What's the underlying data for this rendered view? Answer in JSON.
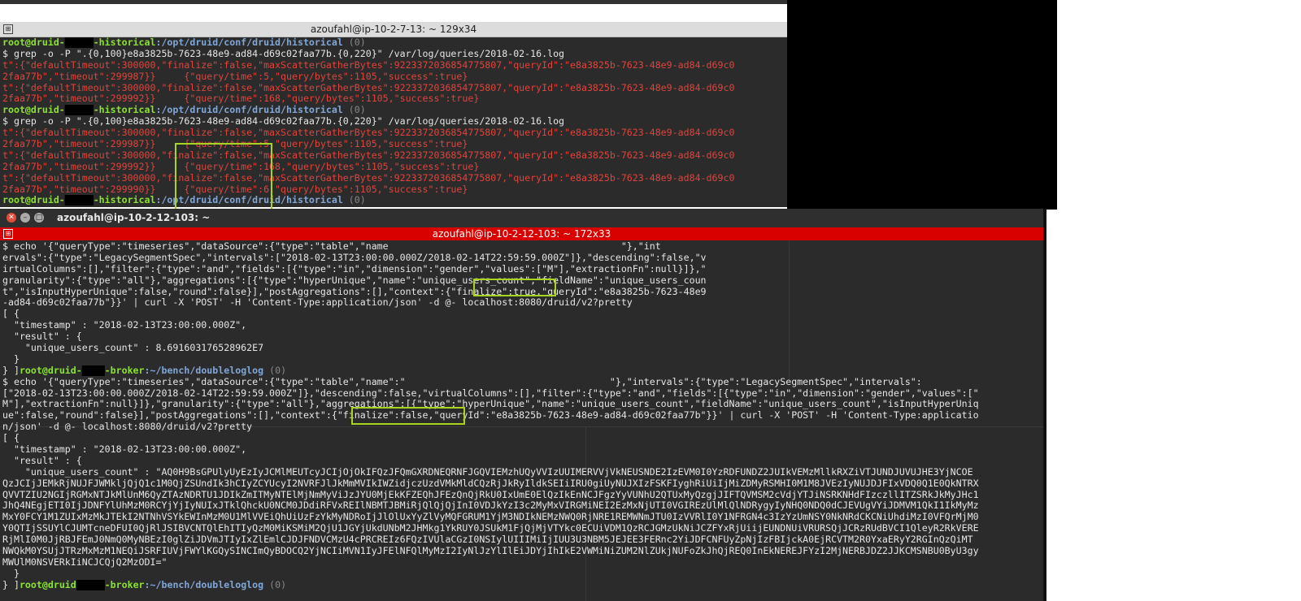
{
  "top_window": {
    "title": "azoufahl@ip-10-2-7-13: ~ 129x34",
    "lines": [
      [
        {
          "t": "root@druid-",
          "c": "green"
        },
        {
          "t": "█████",
          "c": "redact"
        },
        {
          "t": "-historical",
          "c": "green"
        },
        {
          "t": ":/opt/druid/conf/druid/historical",
          "c": "blue"
        },
        {
          "t": " (0)",
          "c": "gray"
        }
      ],
      [
        {
          "t": "$ grep -o -P \".{0,100}e8a3825b-7623-48e9-ad84-d69c02faa77b.{0,220}\" /var/log/queries/2018-02-16.log",
          "c": "white"
        }
      ],
      [
        {
          "t": "t\":{\"defaultTimeout\":300000,\"finalize\":false,\"maxScatterGatherBytes\":9223372036854775807,\"queryId\":\"e8a3825b-7623-48e9-ad84-d69c0",
          "c": "red"
        }
      ],
      [
        {
          "t": "2faa77b\",\"timeout\":299987}}     {\"query/time\":5,\"query/bytes\":1105,\"success\":true}",
          "c": "red"
        }
      ],
      [
        {
          "t": "t\":{\"defaultTimeout\":300000,\"finalize\":false,\"maxScatterGatherBytes\":9223372036854775807,\"queryId\":\"e8a3825b-7623-48e9-ad84-d69c0",
          "c": "red"
        }
      ],
      [
        {
          "t": "2faa77b\",\"timeout\":299992}}     {\"query/time\":168,\"query/bytes\":1105,\"success\":true}",
          "c": "red"
        }
      ],
      [
        {
          "t": "root@druid-",
          "c": "green"
        },
        {
          "t": "█████",
          "c": "redact"
        },
        {
          "t": "-historical",
          "c": "green"
        },
        {
          "t": ":/opt/druid/conf/druid/historical",
          "c": "blue"
        },
        {
          "t": " (0)",
          "c": "gray"
        }
      ],
      [
        {
          "t": "$ grep -o -P \".{0,100}e8a3825b-7623-48e9-ad84-d69c02faa77b.{0,220}\" /var/log/queries/2018-02-16.log",
          "c": "white"
        }
      ],
      [
        {
          "t": "t\":{\"defaultTimeout\":300000,\"finalize\":false,\"maxScatterGatherBytes\":9223372036854775807,\"queryId\":\"e8a3825b-7623-48e9-ad84-d69c0",
          "c": "red"
        }
      ],
      [
        {
          "t": "2faa77b\",\"timeout\":299987}}     {\"query/time\":5,\"query/bytes\":1105,\"success\":true}",
          "c": "red"
        }
      ],
      [
        {
          "t": "t\":{\"defaultTimeout\":300000,\"finalize\":false,\"maxScatterGatherBytes\":9223372036854775807,\"queryId\":\"e8a3825b-7623-48e9-ad84-d69c0",
          "c": "red"
        }
      ],
      [
        {
          "t": "2faa77b\",\"timeout\":299992}}     {\"query/time\":168,\"query/bytes\":1105,\"success\":true}",
          "c": "red"
        }
      ],
      [
        {
          "t": "t\":{\"defaultTimeout\":300000,\"finalize\":false,\"maxScatterGatherBytes\":9223372036854775807,\"queryId\":\"e8a3825b-7623-48e9-ad84-d69c0",
          "c": "red"
        }
      ],
      [
        {
          "t": "2faa77b\",\"timeout\":299990}}     {\"query/time\":6,\"query/bytes\":1105,\"success\":true}",
          "c": "red"
        }
      ],
      [
        {
          "t": "root@druid-",
          "c": "green"
        },
        {
          "t": "█████",
          "c": "redact"
        },
        {
          "t": "-historical",
          "c": "green"
        },
        {
          "t": ":/opt/druid/conf/druid/historical",
          "c": "blue"
        },
        {
          "t": " (0)",
          "c": "gray"
        }
      ]
    ]
  },
  "bottom_window": {
    "header_title": "azoufahl@ip-10-2-12-103: ~",
    "title": "azoufahl@ip-10-2-12-103: ~ 172x33",
    "lines": [
      [
        {
          "t": "$ echo '{\"queryType\":\"timeseries\",\"dataSource\":{\"type\":\"table\",\"name                                         \"},\"int",
          "c": "white"
        }
      ],
      [
        {
          "t": "ervals\":{\"type\":\"LegacySegmentSpec\",\"intervals\":[\"2018-02-13T23:00:00.000Z/2018-02-14T22:59:59.000Z\"]},\"descending\":false,\"v",
          "c": "white"
        }
      ],
      [
        {
          "t": "irtualColumns\":[],\"filter\":{\"type\":\"and\",\"fields\":[{\"type\":\"in\",\"dimension\":\"gender\",\"values\":[\"M\"],\"extractionFn\":null}]},\"",
          "c": "white"
        }
      ],
      [
        {
          "t": "granularity\":{\"type\":\"all\"},\"aggregations\":[{\"type\":\"hyperUnique\",\"name\":\"unique_users_count\",\"fieldName\":\"unique_users_coun",
          "c": "white"
        }
      ],
      [
        {
          "t": "t\",\"isInputHyperUnique\":false,\"round\":false}],\"postAggregations\":[],\"context\":{\"finalize\":true,\"queryId\":\"e8a3825b-7623-48e9",
          "c": "white"
        }
      ],
      [
        {
          "t": "-ad84-d69c02faa77b\"}}' | curl -X 'POST' -H 'Content-Type:application/json' -d @- localhost:8080/druid/v2?pretty",
          "c": "white"
        }
      ],
      [
        {
          "t": "[ {",
          "c": "white"
        }
      ],
      [
        {
          "t": "  \"timestamp\" : \"2018-02-13T23:00:00.000Z\",",
          "c": "white"
        }
      ],
      [
        {
          "t": "  \"result\" : {",
          "c": "white"
        }
      ],
      [
        {
          "t": "    \"unique_users_count\" : 8.691603176528962E7",
          "c": "white"
        }
      ],
      [
        {
          "t": "  }",
          "c": "white"
        }
      ],
      [
        {
          "t": "} ]",
          "c": "white"
        },
        {
          "t": "root@druid-",
          "c": "green"
        },
        {
          "t": "████",
          "c": "redact"
        },
        {
          "t": "-broker",
          "c": "green"
        },
        {
          "t": ":~/bench/doubleloglog",
          "c": "blue"
        },
        {
          "t": " (0)",
          "c": "gray"
        }
      ],
      [
        {
          "t": "$ echo '{\"queryType\":\"timeseries\",\"dataSource\":{\"type\":\"table\",\"name\":\"                                    \"},\"intervals\":{\"type\":\"LegacySegmentSpec\",\"intervals\":",
          "c": "white"
        }
      ],
      [
        {
          "t": "[\"2018-02-13T23:00:00.000Z/2018-02-14T22:59:59.000Z\"]},\"descending\":false,\"virtualColumns\":[],\"filter\":{\"type\":\"and\",\"fields\":[{\"type\":\"in\",\"dimension\":\"gender\",\"values\":[\"",
          "c": "white"
        }
      ],
      [
        {
          "t": "M\"],\"extractionFn\":null}]},\"granularity\":{\"type\":\"all\"},\"aggregations\":[{\"type\":\"hyperUnique\",\"name\":\"unique_users_count\",\"fieldName\":\"unique_users_count\",\"isInputHyperUniq",
          "c": "white"
        }
      ],
      [
        {
          "t": "ue\":false,\"round\":false}],\"postAggregations\":[],\"context\":{\"finalize\":false,\"queryId\":\"e8a3825b-7623-48e9-ad84-d69c02faa77b\"}}' | curl -X 'POST' -H 'Content-Type:applicatio",
          "c": "white"
        }
      ],
      [
        {
          "t": "n/json' -d @- localhost:8080/druid/v2?pretty",
          "c": "white"
        }
      ],
      [
        {
          "t": "[ {",
          "c": "white"
        }
      ],
      [
        {
          "t": "  \"timestamp\" : \"2018-02-13T23:00:00.000Z\",",
          "c": "white"
        }
      ],
      [
        {
          "t": "  \"result\" : {",
          "c": "white"
        }
      ],
      [
        {
          "t": "    \"unique_users_count\" : \"AQ0H9BsGPUlyUyEzIyJCMlMEUTcyJCIjOjOkIFQzJFQmGXRDNEQRNFJGQVIEMzhUQyVVIzUUIMERVVjVkNEUSNDE2IzEVM0I0YzRDFUNDZ2JUIkVEMzMllkRXZiVTJUNDJUVUJHE3YjNCOE",
          "c": "white"
        }
      ],
      [
        {
          "t": "QzJCIjJEMkRjNUJFJWMkljQjQ1c1M0QjZSUndIk3hCIyZCYUcyI2NVRFJlJkMmMVIkIWZidjczUzdVMkMldCQzRjJkRyIldkSEIiIRU0giUyNUJXIzFSKFIyghRiUiIjMiZDMyRSMHI0M1M8JVEzIyNUJDJFIxVDQ0Q1E0QkNTRX",
          "c": "white"
        }
      ],
      [
        {
          "t": "QVVTZIU2NGIjRGMxNTJkMlUnM6QyZTAzNDRTU1JDIkZmITMyNTElMjNmMyViJzJYU0MjEkKFZEQhJFEzQnQjRkU0IxUmE0ElQzIkEnNCJFgzYyVUNhU2QTUxMyQzgjJIFTQVMSM2cVdjYTJiNSRKNHdFIzczllITZSRkJkMyJHc1",
          "c": "white"
        }
      ],
      [
        {
          "t": "JhQ4NEgjETI0IjJDNFYlUhMzM0RCYjYjIyNUIxJTklQhckU0NCM0JDdiRFVxREIlNBMTJBMiRjQlQjQjInI0VDJkYzI3c2MyMxVIRGMiNEI2EzMxNjUTI0VGIREzUlMlQlNDRygyIyNHQ0NDQ0dCJEVUgVYiJDMVM1QkI1IkMyMz",
          "c": "white"
        }
      ],
      [
        {
          "t": "MxY0FCY1M1ZUIxMzMkJTEkI2NTNhVSYkEWInMzM0U1MlVVEiQhUiUzFzYkMyNDRoIjJlOlUxYyZlVyMQFGRUM1YjM3NDIkNEMzNWQ0RjNRE1REMWNmJTU0IzVVRlI0Y1NFRGN4c3IzYzUmNSY0NkNRdCKCNiUhdiMzI0VFQrMjM0",
          "c": "white"
        }
      ],
      [
        {
          "t": "Y0QTIjSSUYlCJUMTcneDFUI0QjRlJSIBVCNTQlEhITIyQzM0MiKSMiM2QjU1JGYjUkdUNbM2JHMkg1YkRUY0JSUkM1FjQjMjVTYkc0ECUiVDM1QzRCJGMzUkNiJCZFYxRjUiijEUNDNUiVRURSQjJCRzRUdBVCI1QleyR2RkVERE",
          "c": "white"
        }
      ],
      [
        {
          "t": "RjMlI0M0JjRBJFEmJ0NmQ0MyNBEzI0glZiJDVmJTIyIxZlEmlCJDJFNDVCMzU4cPRCREIz6FQzIVUlaCGzI0NSIylUIIIMiIjIUU3U3NBM5JEJEE3FERnc2YiJDFCNFUyZpNjIzFBIjckA0EjRCVTM2R0YxaERyY2RGInQzQiMT",
          "c": "white"
        }
      ],
      [
        {
          "t": "NWQkM0YSUjJTRzMxMzM1NEQiJSRFIUVjFWYlKGQySINCImQyBDOCQ2YjNCIiMVN1IyJFElNFQlMyMzI2IyNlJzYlIlEiJDYjIhIkE2VWMiNiZUM2NlZUkjNUFoZkJhQjREQ0InEkNEREJFYzI2MjNERBJDZ2JJKCMSNBU0ByU3gy",
          "c": "white"
        }
      ],
      [
        {
          "t": "MWUlM0NSVERkIiNCJCQjQ2MzODI=\"",
          "c": "white"
        }
      ],
      [
        {
          "t": "  }",
          "c": "white"
        }
      ],
      [
        {
          "t": "} ]",
          "c": "white"
        },
        {
          "t": "root@druid",
          "c": "green"
        },
        {
          "t": "-████",
          "c": "redact"
        },
        {
          "t": "-broker",
          "c": "green"
        },
        {
          "t": ":~/bench/doubleloglog",
          "c": "blue"
        },
        {
          "t": " (0)",
          "c": "gray"
        }
      ]
    ]
  }
}
